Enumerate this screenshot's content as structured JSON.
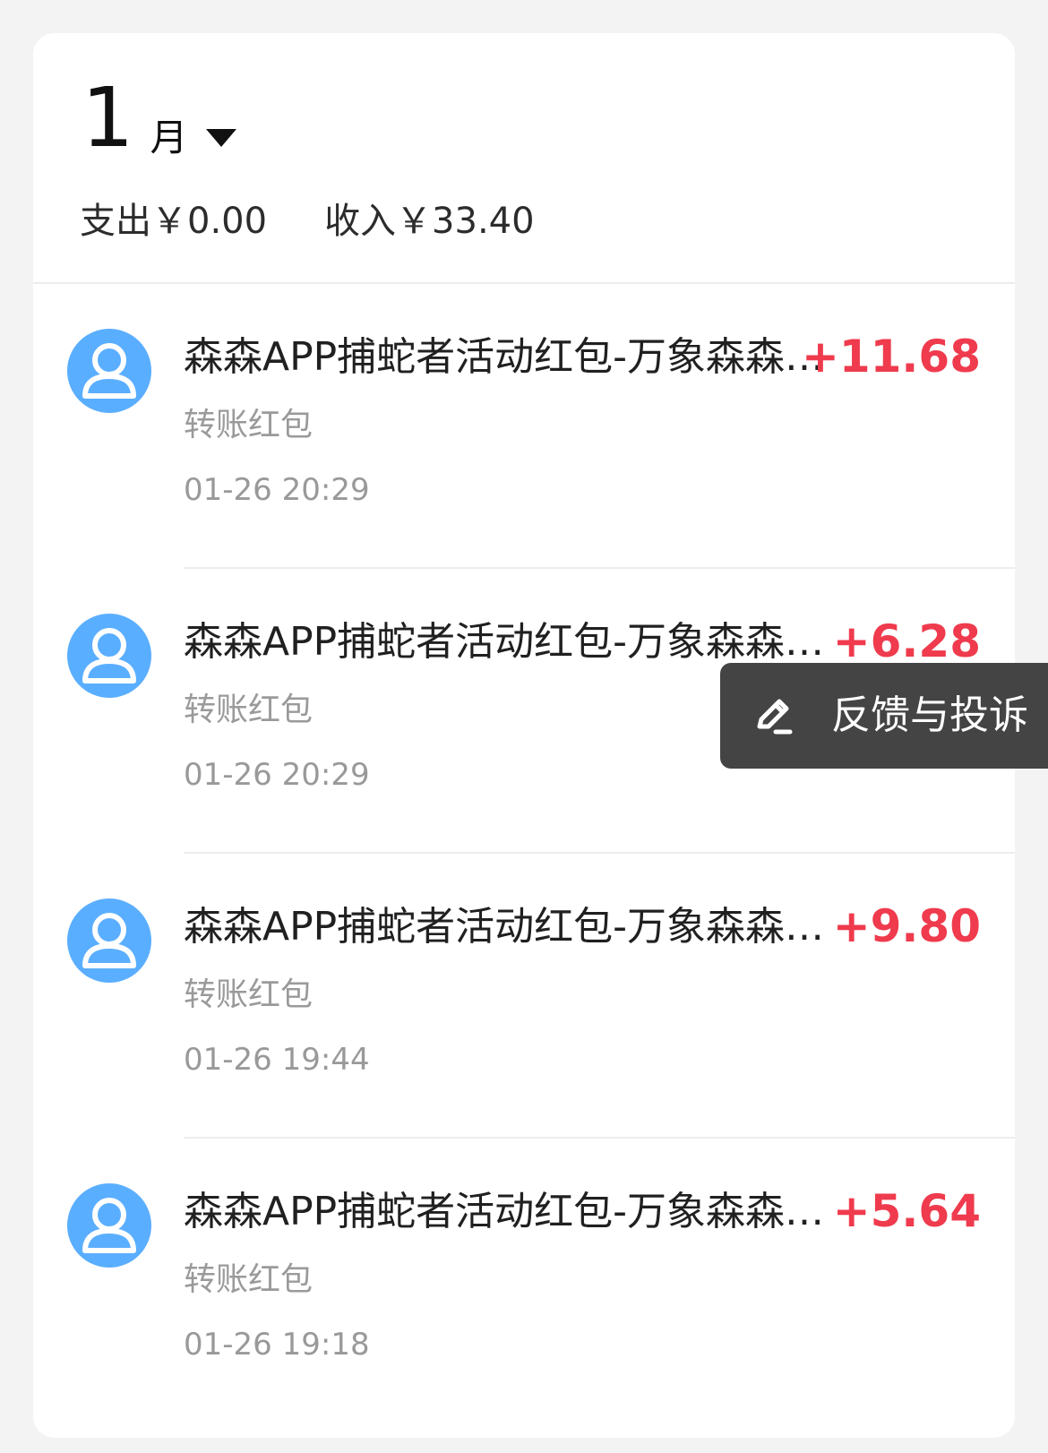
{
  "month": {
    "number": "1",
    "unit": "月",
    "caret_icon": "caret-down-icon"
  },
  "summary": {
    "expense": "支出￥0.00",
    "income": "收入￥33.40"
  },
  "transactions": [
    {
      "title": "森森APP捕蛇者活动红包-万象森森…",
      "amount": "+11.68",
      "type": "转账红包",
      "time": "01-26 20:29",
      "avatar_icon": "user-icon"
    },
    {
      "title": "森森APP捕蛇者活动红包-万象森森…",
      "amount": "+6.28",
      "type": "转账红包",
      "time": "01-26 20:29",
      "avatar_icon": "user-icon"
    },
    {
      "title": "森森APP捕蛇者活动红包-万象森森…",
      "amount": "+9.80",
      "type": "转账红包",
      "time": "01-26 19:44",
      "avatar_icon": "user-icon"
    },
    {
      "title": "森森APP捕蛇者活动红包-万象森森…",
      "amount": "+5.64",
      "type": "转账红包",
      "time": "01-26 19:18",
      "avatar_icon": "user-icon"
    }
  ],
  "feedback": {
    "label": "反馈与投诉",
    "icon": "edit-icon"
  },
  "colors": {
    "background": "#f3f3f3",
    "card": "#ffffff",
    "avatar": "#5aaeff",
    "income_amount": "#ef3b4d",
    "feedback_bg": "#444444"
  }
}
